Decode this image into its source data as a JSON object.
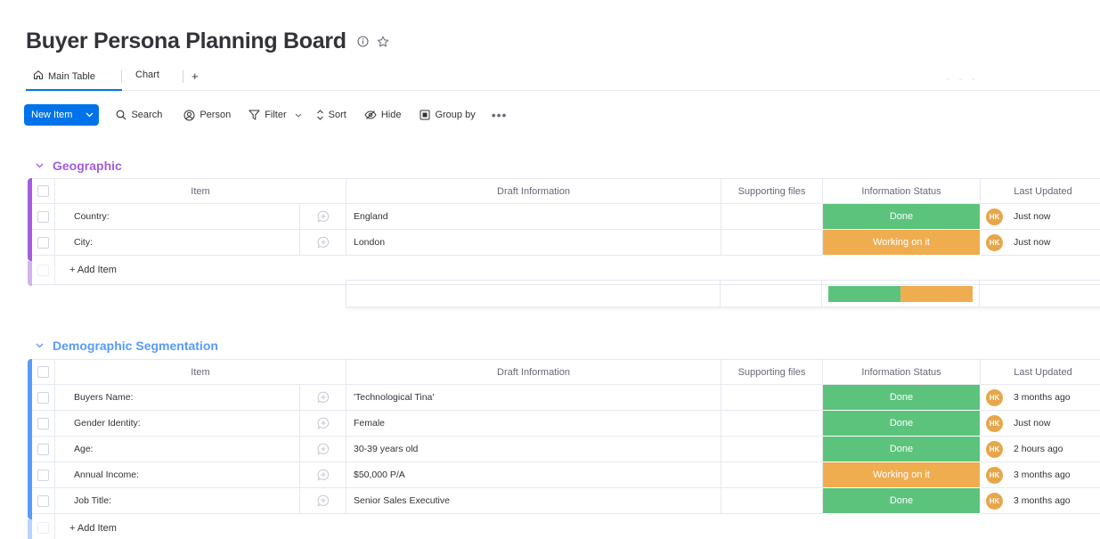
{
  "board": {
    "title": "Buyer Persona Planning Board",
    "info_icon": "info-icon",
    "star_icon": "star-icon"
  },
  "tabs": [
    {
      "label": "Main Table",
      "icon": "home-icon",
      "active": true
    },
    {
      "label": "Chart",
      "active": false
    },
    {
      "label": "+",
      "icon": "plus-icon"
    }
  ],
  "toolbar": {
    "new_item_label": "New Item",
    "search_label": "Search",
    "person_label": "Person",
    "filter_label": "Filter",
    "sort_label": "Sort",
    "hide_label": "Hide",
    "group_by_label": "Group by",
    "more_label": "•••"
  },
  "colors": {
    "accent": "#0073ea",
    "done": "#5cc37c",
    "working": "#efad4f",
    "geographic": "#a25ddc",
    "demographic": "#579bfc",
    "avatar": "#e8a64c"
  },
  "columns": {
    "item": "Item",
    "draft": "Draft Information",
    "files": "Supporting files",
    "status": "Information Status",
    "updated": "Last Updated"
  },
  "add_item_label": "+ Add Item",
  "groups": [
    {
      "name": "Geographic",
      "color": "#a25ddc",
      "rows": [
        {
          "item": "Country:",
          "draft": "England",
          "files": "",
          "status": "Done",
          "avatar": "HK",
          "updated": "Just now"
        },
        {
          "item": "City:",
          "draft": "London",
          "files": "",
          "status": "Working on it",
          "avatar": "HK",
          "updated": "Just now"
        }
      ],
      "summary": {
        "done_fraction": 0.5,
        "working_fraction": 0.5
      }
    },
    {
      "name": "Demographic Segmentation",
      "color": "#579bfc",
      "rows": [
        {
          "item": "Buyers Name:",
          "draft": "'Technological Tina'",
          "files": "",
          "status": "Done",
          "avatar": "HK",
          "updated": "3 months ago"
        },
        {
          "item": "Gender Identity:",
          "draft": "Female",
          "files": "",
          "status": "Done",
          "avatar": "HK",
          "updated": "Just now"
        },
        {
          "item": "Age:",
          "draft": "30-39 years old",
          "files": "",
          "status": "Done",
          "avatar": "HK",
          "updated": "2 hours ago"
        },
        {
          "item": "Annual Income:",
          "draft": "$50,000 P/A",
          "files": "",
          "status": "Working on it",
          "avatar": "HK",
          "updated": "3 months ago"
        },
        {
          "item": "Job Title:",
          "draft": "Senior Sales Executive",
          "files": "",
          "status": "Done",
          "avatar": "HK",
          "updated": "3 months ago"
        }
      ]
    }
  ]
}
